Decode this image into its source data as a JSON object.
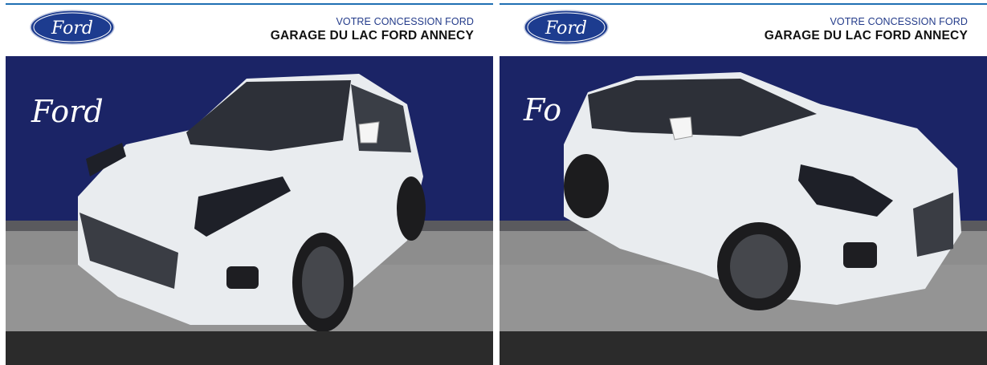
{
  "listing": {
    "dealer_tagline": "VOTRE CONCESSION FORD",
    "dealer_name": "GARAGE DU LAC FORD ANNECY"
  },
  "gallery": [
    {
      "view": "front-left three-quarter view of white Ford Puma",
      "wall_logo": "Ford"
    },
    {
      "view": "front-right three-quarter view of white Ford Puma",
      "wall_logo": "Ford"
    }
  ],
  "colors": {
    "ford_blue": "#1d3c8f",
    "showroom_wall": "#1b2466",
    "floor": "#8a8a8a",
    "bottom_bar": "#2b2b2b"
  }
}
